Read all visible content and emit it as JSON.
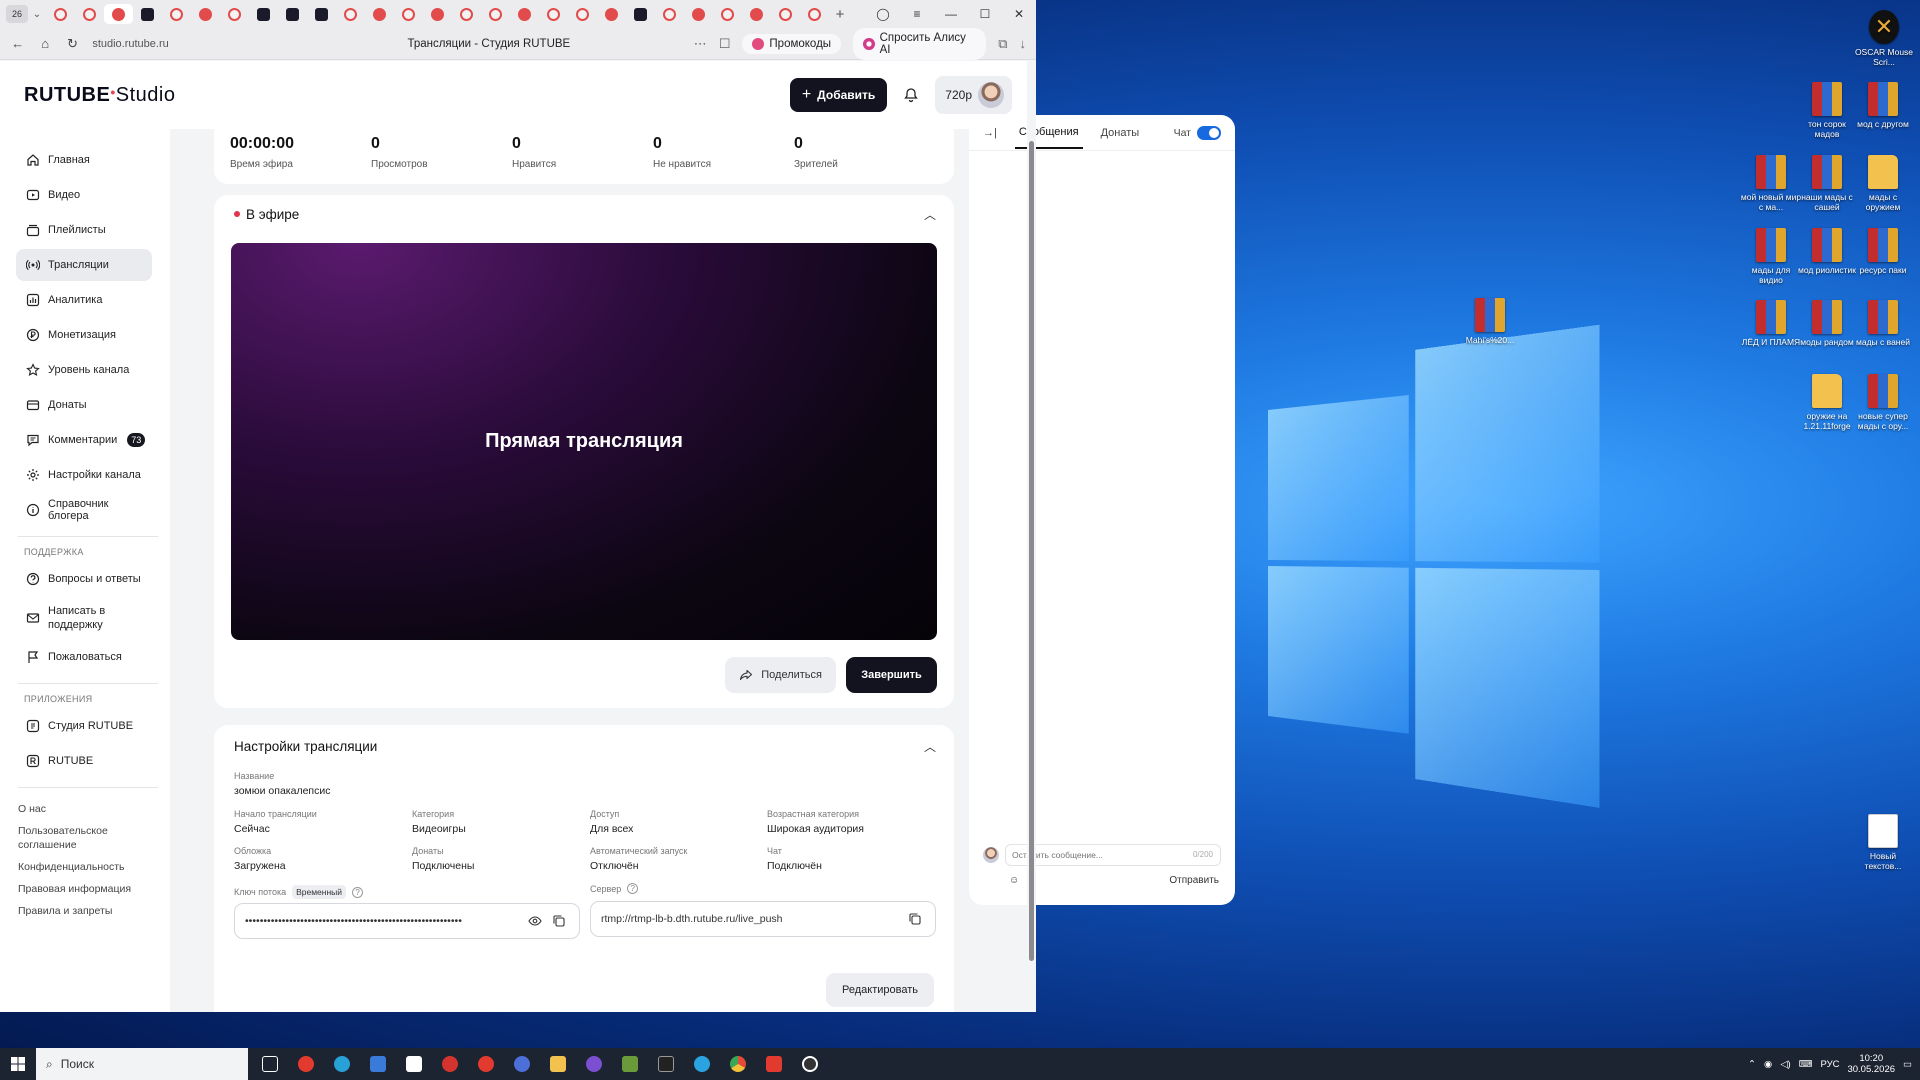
{
  "desktop": {
    "icons": [
      {
        "label": "OSCAR Mouse Scri...",
        "kind": "oscar"
      },
      {
        "label": "тон сорок мадов",
        "kind": "rar"
      },
      {
        "label": "мод с другом",
        "kind": "rar"
      },
      {
        "label": "мой новый мир с ма...",
        "kind": "rar"
      },
      {
        "label": "наши мады с сашей",
        "kind": "rar"
      },
      {
        "label": "мады с оружием",
        "kind": "folder"
      },
      {
        "label": "мады для видио",
        "kind": "rar"
      },
      {
        "label": "мод риолистик",
        "kind": "rar"
      },
      {
        "label": "ресурс паки",
        "kind": "rar"
      },
      {
        "label": "Mahi's%20...",
        "kind": "rar"
      },
      {
        "label": "ЛЁД И ПЛАМЯ",
        "kind": "rar"
      },
      {
        "label": "моды рандом",
        "kind": "rar"
      },
      {
        "label": "мады с ваней",
        "kind": "rar"
      },
      {
        "label": "оружие на 1.21.11forge",
        "kind": "folder"
      },
      {
        "label": "новые супер мады с ору...",
        "kind": "rar"
      },
      {
        "label": "Новый текстов...",
        "kind": "file"
      }
    ]
  },
  "browser": {
    "tab_count": "26",
    "url": "studio.rutube.ru",
    "page_title": "Трансляции - Студия RUTUBE",
    "promo_label": "Промокоды",
    "alisa_label": "Спросить Алису AI"
  },
  "app": {
    "logo_main": "RUTUBE",
    "logo_sub": "Studio",
    "add_label": "Добавить",
    "quality": "720p",
    "nav": [
      {
        "label": "Главная",
        "icon": "home-icon"
      },
      {
        "label": "Видео",
        "icon": "video-icon"
      },
      {
        "label": "Плейлисты",
        "icon": "playlist-icon"
      },
      {
        "label": "Трансляции",
        "icon": "broadcast-icon"
      },
      {
        "label": "Аналитика",
        "icon": "analytics-icon"
      },
      {
        "label": "Монетизация",
        "icon": "monetization-icon"
      },
      {
        "label": "Уровень канала",
        "icon": "star-icon"
      },
      {
        "label": "Донаты",
        "icon": "donate-icon"
      },
      {
        "label": "Комментарии",
        "icon": "comment-icon",
        "badge": "73"
      },
      {
        "label": "Настройки канала",
        "icon": "gear-icon"
      },
      {
        "label": "Справочник блогера",
        "icon": "info-icon"
      }
    ],
    "support_heading": "ПОДДЕРЖКА",
    "support": [
      {
        "label": "Вопросы и ответы",
        "icon": "question-icon"
      },
      {
        "label": "Написать в поддержку",
        "icon": "mail-icon"
      },
      {
        "label": "Пожаловаться",
        "icon": "flag-icon"
      }
    ],
    "apps_heading": "ПРИЛОЖЕНИЯ",
    "apps": [
      {
        "label": "Студия RUTUBE",
        "icon": "studio-app-icon"
      },
      {
        "label": "RUTUBE",
        "icon": "rutube-app-icon"
      }
    ],
    "footer": [
      "О нас",
      "Пользовательское соглашение",
      "Конфиденциальность",
      "Правовая информация",
      "Правила и запреты"
    ],
    "stats": [
      {
        "value": "00:00:00",
        "label": "Время эфира"
      },
      {
        "value": "0",
        "label": "Просмотров"
      },
      {
        "value": "0",
        "label": "Нравится"
      },
      {
        "value": "0",
        "label": "Не нравится"
      },
      {
        "value": "0",
        "label": "Зрителей"
      }
    ],
    "live": {
      "title": "В эфире",
      "player_text": "Прямая трансляция",
      "share_label": "Поделиться",
      "end_label": "Завершить"
    },
    "settings": {
      "title": "Настройки трансляции",
      "name_label": "Название",
      "name_value": "зомюи опакалепсис",
      "fields": [
        {
          "label": "Начало трансляции",
          "value": "Сейчас"
        },
        {
          "label": "Категория",
          "value": "Видеоигры"
        },
        {
          "label": "Доступ",
          "value": "Для всех"
        },
        {
          "label": "Возрастная категория",
          "value": "Широкая аудитория"
        },
        {
          "label": "Обложка",
          "value": "Загружена"
        },
        {
          "label": "Донаты",
          "value": "Подключены"
        },
        {
          "label": "Автоматический запуск",
          "value": "Отключён"
        },
        {
          "label": "Чат",
          "value": "Подключён"
        }
      ],
      "key_label": "Ключ потока",
      "key_tag": "Временный",
      "key_value": "•••••••••••••••••••••••••••••••••••••••••••••••••••••••••••",
      "server_label": "Сервер",
      "server_value": "rtmp://rtmp-lb-b.dth.rutube.ru/live_push",
      "edit_label": "Редактировать"
    },
    "chat": {
      "tab_messages": "Сообщения",
      "tab_donates": "Донаты",
      "toggle_label": "Чат",
      "placeholder": "Оставить сообщение...",
      "counter": "0/200",
      "send_label": "Отправить"
    }
  },
  "taskbar": {
    "search_label": "Поиск",
    "lang": "РУС",
    "time": "10:20",
    "date": "30.05.2026"
  }
}
